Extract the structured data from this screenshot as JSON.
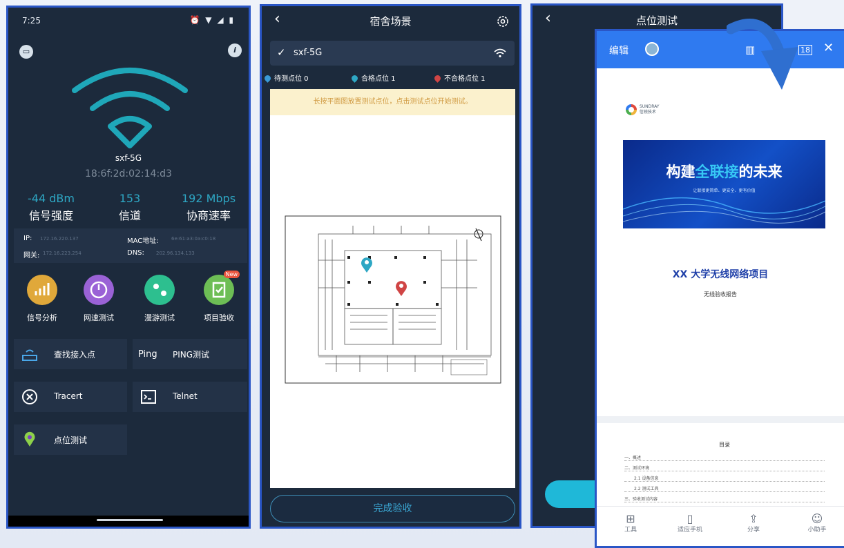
{
  "phone1": {
    "time": "7:25",
    "status_icons": "⏰ ▼ ◢ ▮",
    "ssid": "sxf-5G",
    "mac": "18:6f:2d:02:14:d3",
    "stats": [
      {
        "value": "-44 dBm",
        "label": "信号强度"
      },
      {
        "value": "153",
        "label": "信道"
      },
      {
        "value": "192 Mbps",
        "label": "协商速率"
      }
    ],
    "info": {
      "ip_label": "IP:",
      "ip_value": "172.16.220.137",
      "mac_label": "MAC地址:",
      "mac_value": "6e:61:a3:0a:c0:18",
      "gw_label": "网关:",
      "gw_value": "172.16.223.254",
      "dns_label": "DNS:",
      "dns_value": "202.96.134.133"
    },
    "tools": [
      {
        "label": "信号分析",
        "color": "#e0a83a",
        "icon": "chart-icon"
      },
      {
        "label": "网速测试",
        "color": "#9a62d6",
        "icon": "speedometer-icon"
      },
      {
        "label": "漫游测试",
        "color": "#2dbf8f",
        "icon": "roaming-icon"
      },
      {
        "label": "项目验收",
        "color": "#6dbe55",
        "icon": "checklist-icon",
        "badge": "New"
      }
    ],
    "cards": [
      {
        "label": "查找接入点",
        "icon": "router-icon"
      },
      {
        "label": "PING测试",
        "icon": "ping-icon",
        "icon_text": "Ping"
      },
      {
        "label": "Tracert",
        "icon": "tracert-icon"
      },
      {
        "label": "Telnet",
        "icon": "terminal-icon"
      },
      {
        "label": "点位测试",
        "icon": "location-pin-icon"
      }
    ]
  },
  "phone2": {
    "title": "宿舍场景",
    "back": "‹",
    "ssid": "sxf-5G",
    "legend": [
      {
        "label": "待测点位 0",
        "color": "#3a9ad6"
      },
      {
        "label": "合格点位 1",
        "color": "#2ea7c4"
      },
      {
        "label": "不合格点位 1",
        "color": "#d04545"
      }
    ],
    "notice": "长按平面图放置测试点位，点击测试点位开始测试。",
    "finish": "完成验收"
  },
  "phone3": {
    "title": "点位测试",
    "back": "‹"
  },
  "doc": {
    "edit": "编辑",
    "logo_line1": "SUNDRAY",
    "logo_line2": "信锐技术",
    "banner_part1": "构建",
    "banner_highlight": "全联接",
    "banner_part2": "的未来",
    "banner_sub": "让联接更简单、更安全、更有价值",
    "project": "XX 大学无线网络项目",
    "report": "无线验收报告",
    "toc_title": "目录",
    "toc": [
      "一、概述",
      "二、测试环境",
      "2.1 设备信息",
      "2.2 测试工具",
      "三、验收测试内容"
    ],
    "toolbar": [
      {
        "label": "工具",
        "icon": "grid-icon"
      },
      {
        "label": "适应手机",
        "icon": "phone-fit-icon"
      },
      {
        "label": "分享",
        "icon": "share-icon"
      },
      {
        "label": "小助手",
        "icon": "assistant-icon"
      }
    ]
  }
}
